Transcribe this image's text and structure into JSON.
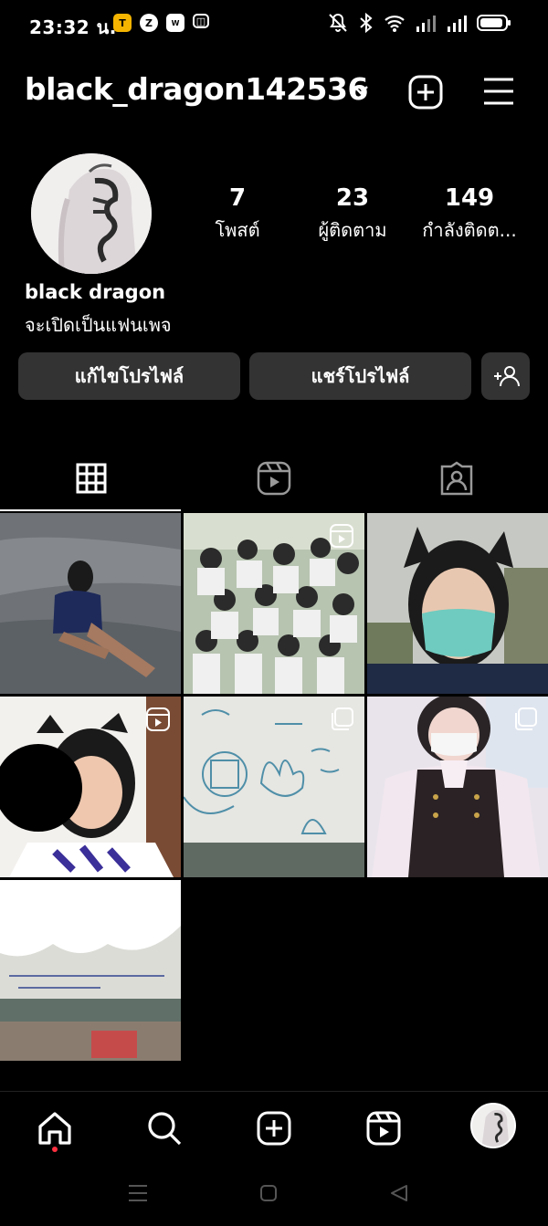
{
  "status_bar": {
    "time": "23:32 น.",
    "apps": [
      {
        "name": "flashlight-app-icon",
        "glyph": "T",
        "bg": "#f4b400",
        "fg": "#000"
      },
      {
        "name": "zalo-app-icon",
        "glyph": "Z",
        "bg": "#ffffff",
        "fg": "#000"
      },
      {
        "name": "webtoon-app-icon",
        "glyph": "W",
        "bg": "#ffffff",
        "fg": "#000"
      },
      {
        "name": "bilibili-app-icon",
        "glyph": "◫",
        "bg": "#000",
        "fg": "#fff"
      }
    ]
  },
  "header": {
    "username": "black_dragon142536"
  },
  "profile": {
    "posts": {
      "count": "7",
      "label": "โพสต์"
    },
    "followers": {
      "count": "23",
      "label": "ผู้ติดตาม"
    },
    "following": {
      "count": "149",
      "label": "กำลังติดต..."
    },
    "display_name": "black dragon",
    "bio": "จะเปิดเป็นแฟนเพจ"
  },
  "buttons": {
    "edit_profile": "แก้ไขโปรไฟล์",
    "share_profile": "แชร์โปรไฟล์"
  },
  "tabs": [
    {
      "name": "tab-grid",
      "icon": "grid-icon",
      "active": true
    },
    {
      "name": "tab-reels",
      "icon": "reels-icon",
      "active": false
    },
    {
      "name": "tab-tagged",
      "icon": "tagged-icon",
      "active": false
    }
  ],
  "posts": [
    {
      "id": 1,
      "type": "photo",
      "description": "girl sitting in water"
    },
    {
      "id": 2,
      "type": "reel",
      "description": "group of students"
    },
    {
      "id": 3,
      "type": "photo",
      "description": "selfie with cat ears and mask"
    },
    {
      "id": 4,
      "type": "reel",
      "description": "girl with cat ears, face covered"
    },
    {
      "id": 5,
      "type": "carousel",
      "description": "whiteboard drawing"
    },
    {
      "id": 6,
      "type": "carousel",
      "description": "girl in uniform with mask"
    },
    {
      "id": 7,
      "type": "carousel",
      "description": "whiteboard with scribbled text"
    }
  ],
  "bottom_nav": [
    {
      "name": "nav-home",
      "icon": "home-icon"
    },
    {
      "name": "nav-search",
      "icon": "search-icon"
    },
    {
      "name": "nav-create",
      "icon": "create-icon"
    },
    {
      "name": "nav-reels",
      "icon": "reels-icon"
    },
    {
      "name": "nav-profile",
      "icon": "profile-avatar"
    }
  ],
  "colors": {
    "background": "#000000",
    "button": "#333333",
    "notification_dot": "#ff3040"
  }
}
